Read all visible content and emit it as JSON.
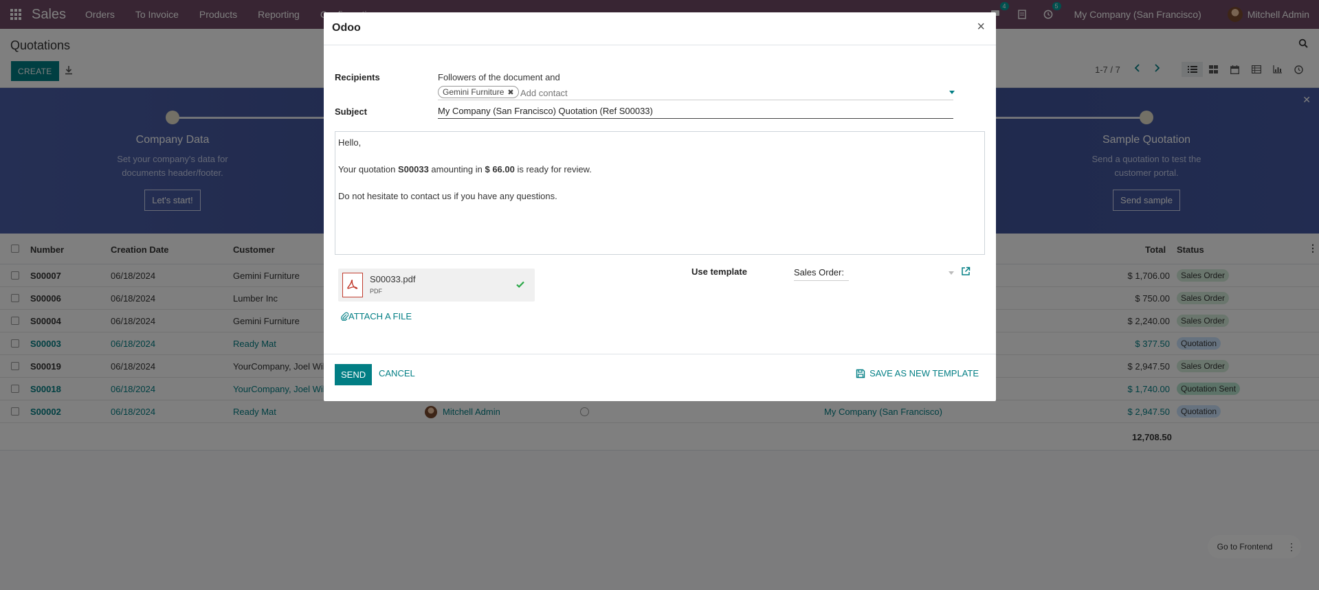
{
  "navbar": {
    "app_name": "Sales",
    "menus": [
      "Orders",
      "To Invoice",
      "Products",
      "Reporting",
      "Configuration"
    ],
    "chat_count": "4",
    "activity_count": "5",
    "company": "My Company (San Francisco)",
    "user": "Mitchell Admin"
  },
  "control": {
    "title": "Quotations",
    "create_label": "CREATE",
    "pager": "1-7 / 7"
  },
  "banner": {
    "steps": [
      {
        "title": "Company Data",
        "desc": "Set your company's data for documents header/footer.",
        "button": "Let's start!"
      },
      {
        "title": "Sample Quotation",
        "desc": "Send a quotation to test the customer portal.",
        "button": "Send sample"
      }
    ]
  },
  "table": {
    "headers": {
      "number": "Number",
      "creation_date": "Creation Date",
      "customer": "Customer",
      "total": "Total",
      "status": "Status"
    },
    "rows": [
      {
        "number": "S00007",
        "date": "06/18/2024",
        "customer": "Gemini Furniture",
        "salesperson": "",
        "company": "",
        "total": "$ 1,706.00",
        "status": "Sales Order",
        "blue": false
      },
      {
        "number": "S00006",
        "date": "06/18/2024",
        "customer": "Lumber Inc",
        "salesperson": "",
        "company": "",
        "total": "$ 750.00",
        "status": "Sales Order",
        "blue": false
      },
      {
        "number": "S00004",
        "date": "06/18/2024",
        "customer": "Gemini Furniture",
        "salesperson": "",
        "company": "",
        "total": "$ 2,240.00",
        "status": "Sales Order",
        "blue": false
      },
      {
        "number": "S00003",
        "date": "06/18/2024",
        "customer": "Ready Mat",
        "salesperson": "",
        "company": "",
        "total": "$ 377.50",
        "status": "Quotation",
        "blue": true
      },
      {
        "number": "S00019",
        "date": "06/18/2024",
        "customer": "YourCompany, Joel Wil",
        "salesperson": "",
        "company": "",
        "total": "$ 2,947.50",
        "status": "Sales Order",
        "blue": false
      },
      {
        "number": "S00018",
        "date": "06/18/2024",
        "customer": "YourCompany, Joel Wil",
        "salesperson": "",
        "company": "",
        "total": "$ 1,740.00",
        "status": "Quotation Sent",
        "blue": true
      },
      {
        "number": "S00002",
        "date": "06/18/2024",
        "customer": "Ready Mat",
        "salesperson": "Mitchell Admin",
        "company": "My Company (San Francisco)",
        "total": "$ 2,947.50",
        "status": "Quotation",
        "blue": true
      }
    ],
    "grand_total": "12,708.50"
  },
  "status_colors": {
    "Sales Order": "#d4edda",
    "Quotation": "#cce5ff",
    "Quotation Sent": "#b8e6d0"
  },
  "frontend_button": "Go to Frontend",
  "dialog": {
    "title": "Odoo",
    "recipients_label": "Recipients",
    "followers_text": "Followers of the document and",
    "recipient_tag": "Gemini Furniture",
    "add_contact_placeholder": "Add contact",
    "subject_label": "Subject",
    "subject_value": "My Company (San Francisco) Quotation (Ref S00033)",
    "body": {
      "greeting": "Hello,",
      "line1_pre": "Your quotation ",
      "quote_ref": "S00033",
      "line1_mid": " amounting in ",
      "amount": "$ 66.00",
      "line1_post": " is ready for review.",
      "line2": "Do not hesitate to contact us if you have any questions."
    },
    "attachment": {
      "name": "S00033.pdf",
      "type": "PDF"
    },
    "attach_file_label": "ATTACH A FILE",
    "use_template_label": "Use template",
    "template_value": "Sales Order:",
    "send_label": "SEND",
    "cancel_label": "CANCEL",
    "save_template_label": "SAVE AS NEW TEMPLATE"
  },
  "colors": {
    "navbar": "#714B67",
    "primary": "#017e84"
  }
}
